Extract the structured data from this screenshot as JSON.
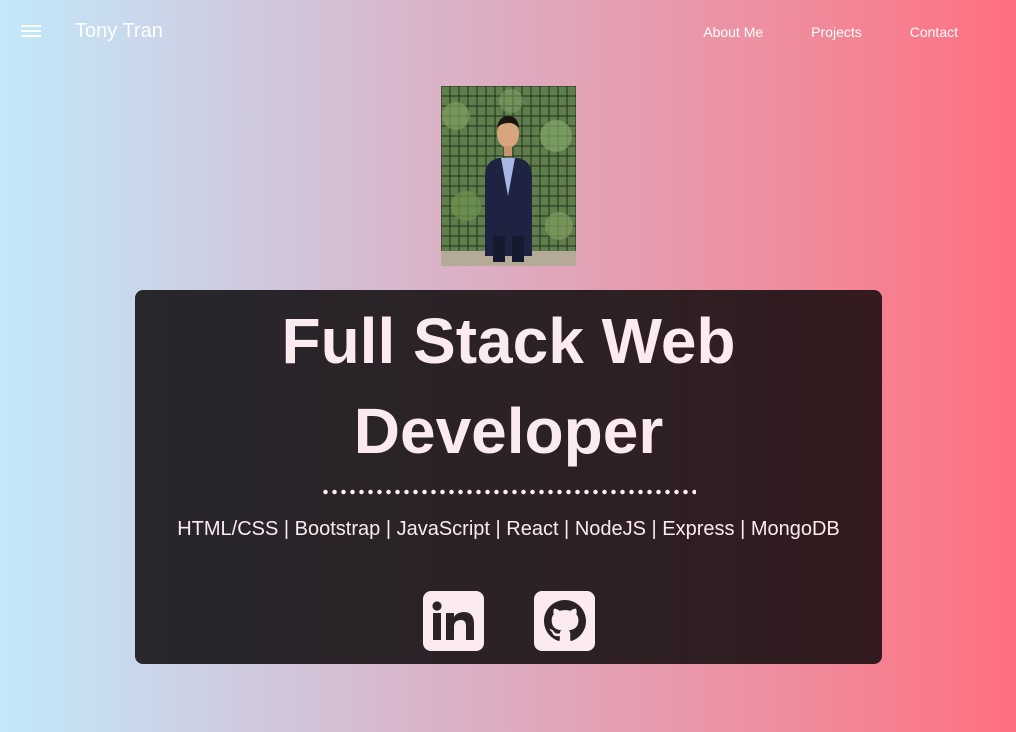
{
  "nav": {
    "brand": "Tony Tran",
    "menu_icon": "hamburger-menu-icon",
    "links": [
      "About Me",
      "Projects",
      "Contact"
    ]
  },
  "hero": {
    "photo": "profile-photo",
    "title": "Full Stack Web Developer",
    "skills": "HTML/CSS | Bootstrap | JavaScript | React | NodeJS | Express | MongoDB",
    "social": [
      {
        "icon": "linkedin-icon"
      },
      {
        "icon": "github-icon"
      }
    ]
  },
  "colors": {
    "bg_left": "#c2e9fb",
    "bg_right": "#ff6f80",
    "card_bg": "#2a2226",
    "card_text": "#fbeaf0"
  }
}
